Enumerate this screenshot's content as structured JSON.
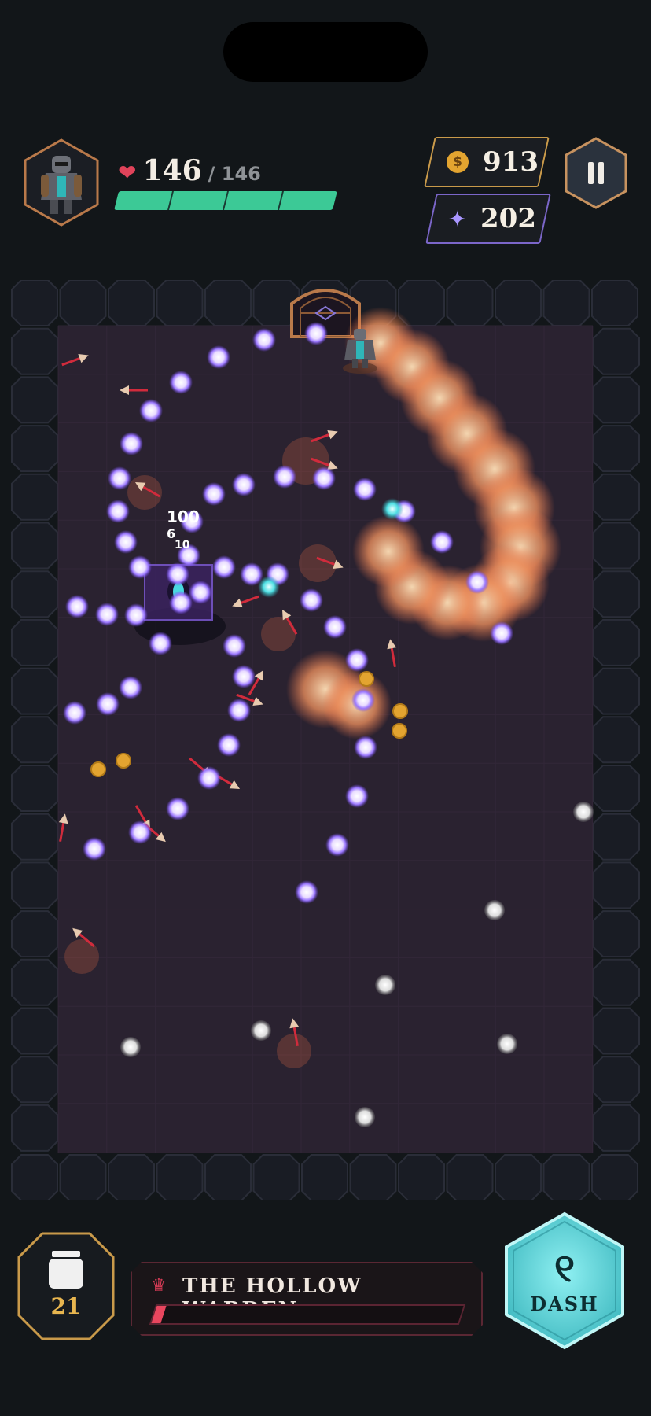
{
  "hud": {
    "hp_current": "146",
    "hp_separator": "/ 146",
    "hp_fraction": 1.0,
    "gold": "913",
    "gold_icon_symbol": "$",
    "gems": "202",
    "icons": {
      "heart": "heart-icon",
      "coin": "coin-icon",
      "gem": "sparkle-icon",
      "pause": "pause-icon"
    }
  },
  "damage_numbers": [
    "100",
    "6",
    "10"
  ],
  "boss": {
    "name": "THE HOLLOW WARDEN",
    "hp_fraction": 0.03,
    "crown_icon": "crown-icon"
  },
  "inventory": {
    "count": "21",
    "icon": "jar-icon"
  },
  "ability": {
    "glyph": "୧",
    "label": "DASH"
  },
  "colors": {
    "background": "#121619",
    "floor": "#2a2230",
    "hp_green": "#3cc996",
    "gold_border": "#c99a4a",
    "gem_border": "#7b66c9",
    "orb_purple": "#a07cff",
    "fire": "#ff9a62",
    "dash_teal": "#5fd6da",
    "boss_red": "#e8465e"
  }
}
